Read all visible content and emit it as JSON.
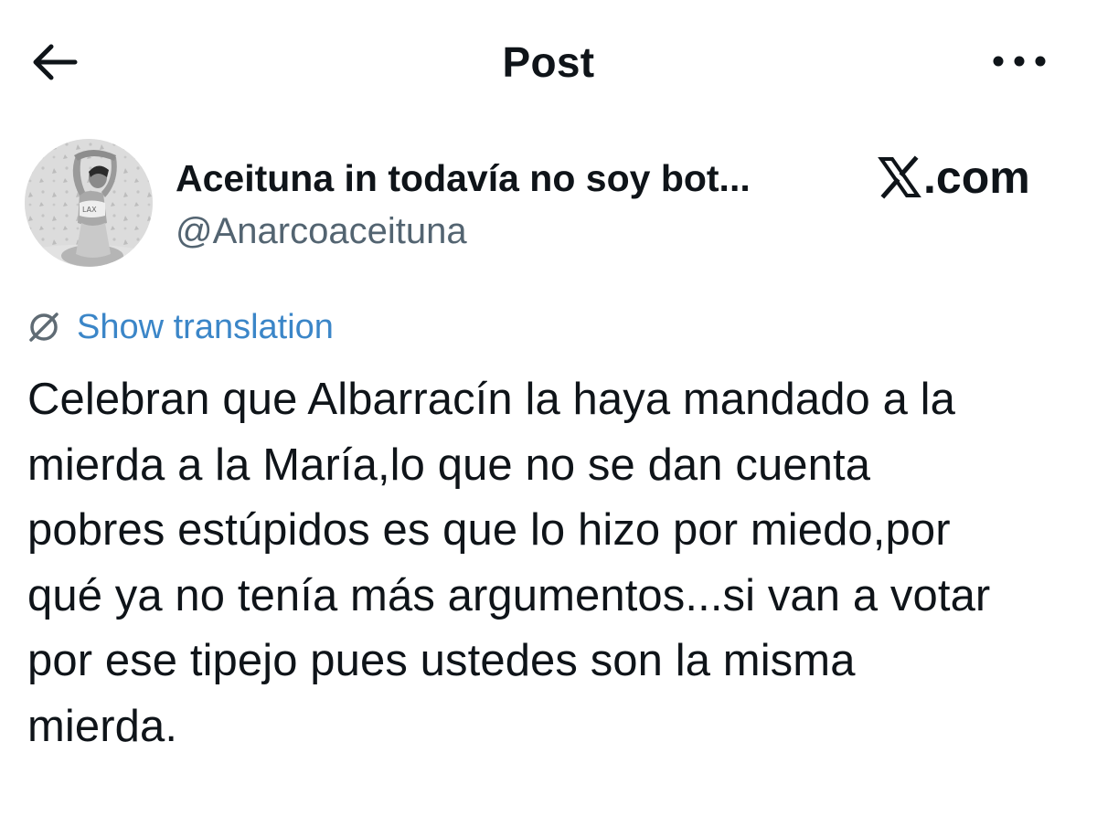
{
  "header": {
    "title": "Post",
    "back_icon": "arrow-left-icon",
    "more_icon": "more-horizontal-icon"
  },
  "author": {
    "display_name": "Aceituna in todavía no soy bot...",
    "handle": "@Anarcoaceituna",
    "avatar_icon": "profile-photo"
  },
  "watermark": {
    "domain": ".com",
    "logo_icon": "x-logo-icon"
  },
  "translation": {
    "label": "Show translation",
    "icon": "translate-icon"
  },
  "post": {
    "lines": [
      "Celebran que Albarracín la haya mandado a la",
      "mierda a la María,lo que no se dan cuenta",
      "pobres estúpidos es que lo hizo por miedo,por",
      "qué ya no tenía más argumentos...si van a votar",
      "por ese tipejo pues ustedes son la misma",
      "mierda."
    ]
  },
  "colors": {
    "text": "#0f1419",
    "secondary": "#536471",
    "link": "#3b86c8",
    "background": "#ffffff"
  }
}
